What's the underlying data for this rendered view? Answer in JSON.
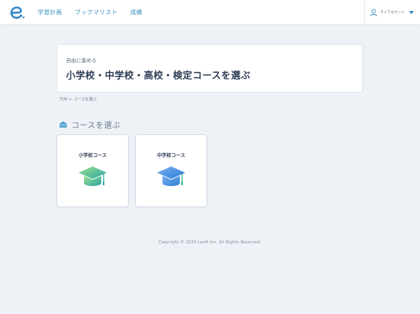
{
  "header": {
    "logo_icon": "e-logo-icon",
    "nav": [
      {
        "label": "学習計画"
      },
      {
        "label": "ブックマリスト"
      },
      {
        "label": "成績"
      }
    ],
    "account": {
      "label": "マイアカウント",
      "icon": "user-icon",
      "caret_icon": "caret-down-icon"
    }
  },
  "hero": {
    "subtitle": "自由に進める",
    "title": "小学校・中学校・高校・検定コースを選ぶ"
  },
  "breadcrumb": {
    "text": "TOP > コースを選ぶ"
  },
  "section": {
    "icon": "school-icon",
    "title": "コースを選ぶ"
  },
  "courses": [
    {
      "label": "小学校コース",
      "icon": "graduation-cap-icon",
      "colors": [
        "#8fdc8a",
        "#2ea9a6"
      ]
    },
    {
      "label": "中学校コース",
      "icon": "graduation-cap-icon",
      "colors": [
        "#78a8ef",
        "#2f85d8"
      ]
    }
  ],
  "footer": {
    "copyright": "Copyright © 2020 Laoft Inc. All Rights Reserved."
  },
  "colors": {
    "accent": "#3a8fbd",
    "background": "#eef2f7"
  }
}
